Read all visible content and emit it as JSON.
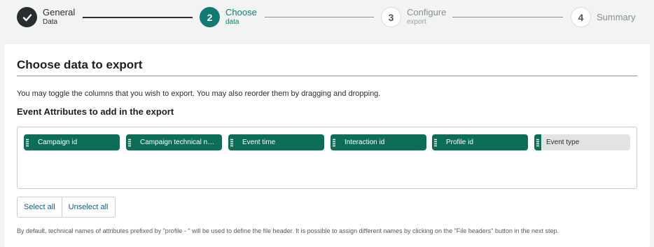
{
  "stepper": {
    "steps": [
      {
        "title": "General",
        "subtitle": "Data",
        "state": "done",
        "icon": "checkmark-icon"
      },
      {
        "number": "2",
        "title": "Choose",
        "subtitle": "data",
        "state": "active"
      },
      {
        "number": "3",
        "title": "Configure",
        "subtitle": "export",
        "state": "todo"
      },
      {
        "number": "4",
        "title": "Summary",
        "subtitle": "",
        "state": "todo"
      }
    ]
  },
  "card": {
    "title": "Choose data to export",
    "description": "You may toggle the columns that you wish to export. You may also reorder them by dragging and dropping.",
    "section_title": "Event Attributes to add in the export",
    "attributes": [
      {
        "label": "Campaign id",
        "selected": true
      },
      {
        "label": "Campaign technical name",
        "selected": true
      },
      {
        "label": "Event time",
        "selected": true
      },
      {
        "label": "Interaction id",
        "selected": true
      },
      {
        "label": "Profile id",
        "selected": true
      },
      {
        "label": "Event type",
        "selected": false
      }
    ],
    "select_all_label": "Select all",
    "unselect_all_label": "Unselect all",
    "footer_note": "By default, technical names of attributes prefixed by \"profile - \" will be used to define the file header. It is possible to assign different names by clicking on the \"File headers\" button in the next step."
  },
  "colors": {
    "accent": "#0f7b73",
    "chip": "#0d6e58",
    "chip_off": "#e2e3e4",
    "background": "#f2f3f3"
  }
}
